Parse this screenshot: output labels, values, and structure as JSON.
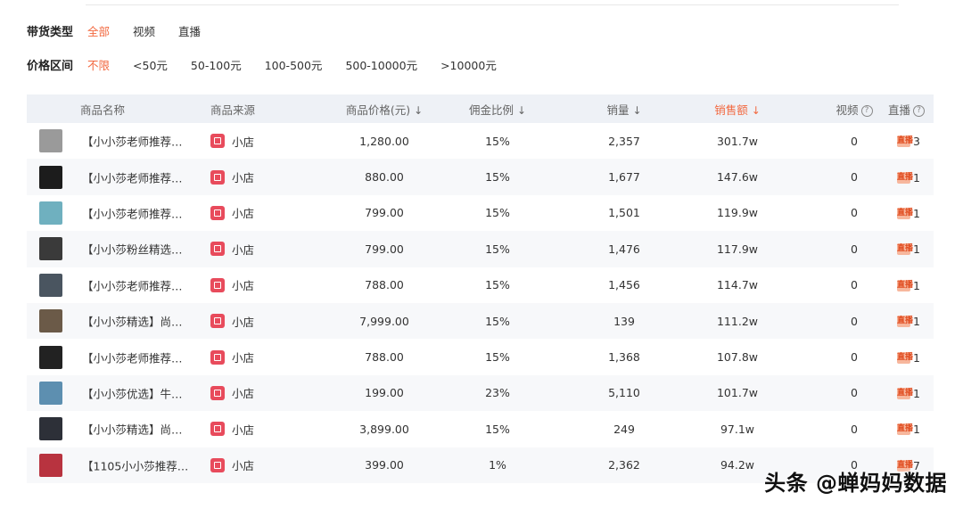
{
  "filters": {
    "type_label": "带货类型",
    "type_options": [
      "全部",
      "视频",
      "直播"
    ],
    "price_label": "价格区间",
    "price_options": [
      "不限",
      "<50元",
      "50-100元",
      "100-500元",
      "500-10000元",
      ">10000元"
    ]
  },
  "table": {
    "headers": {
      "name": "商品名称",
      "source": "商品来源",
      "price": "商品价格(元)",
      "commission": "佣金比例",
      "sales": "销量",
      "revenue": "销售额",
      "video": "视频",
      "live": "直播"
    },
    "sort_arrow": "↓",
    "help_glyph": "?",
    "live_icon_text": "直播",
    "rows": [
      {
        "name": "【小小莎老师推荐…",
        "source": "小店",
        "price": "1,280.00",
        "commission": "15%",
        "sales": "2,357",
        "revenue": "301.7w",
        "video": "0",
        "live": "3",
        "thumb_color": "#9a9a9a"
      },
      {
        "name": "【小小莎老师推荐…",
        "source": "小店",
        "price": "880.00",
        "commission": "15%",
        "sales": "1,677",
        "revenue": "147.6w",
        "video": "0",
        "live": "1",
        "thumb_color": "#1c1c1c"
      },
      {
        "name": "【小小莎老师推荐…",
        "source": "小店",
        "price": "799.00",
        "commission": "15%",
        "sales": "1,501",
        "revenue": "119.9w",
        "video": "0",
        "live": "1",
        "thumb_color": "#6fb0bf"
      },
      {
        "name": "【小小莎粉丝精选…",
        "source": "小店",
        "price": "799.00",
        "commission": "15%",
        "sales": "1,476",
        "revenue": "117.9w",
        "video": "0",
        "live": "1",
        "thumb_color": "#3a3a3a"
      },
      {
        "name": "【小小莎老师推荐…",
        "source": "小店",
        "price": "788.00",
        "commission": "15%",
        "sales": "1,456",
        "revenue": "114.7w",
        "video": "0",
        "live": "1",
        "thumb_color": "#4a5560"
      },
      {
        "name": "【小小莎精选】尚…",
        "source": "小店",
        "price": "7,999.00",
        "commission": "15%",
        "sales": "139",
        "revenue": "111.2w",
        "video": "0",
        "live": "1",
        "thumb_color": "#6b5a48"
      },
      {
        "name": "【小小莎老师推荐…",
        "source": "小店",
        "price": "788.00",
        "commission": "15%",
        "sales": "1,368",
        "revenue": "107.8w",
        "video": "0",
        "live": "1",
        "thumb_color": "#222222"
      },
      {
        "name": "【小小莎优选】牛…",
        "source": "小店",
        "price": "199.00",
        "commission": "23%",
        "sales": "5,110",
        "revenue": "101.7w",
        "video": "0",
        "live": "1",
        "thumb_color": "#5d8fb0"
      },
      {
        "name": "【小小莎精选】尚…",
        "source": "小店",
        "price": "3,899.00",
        "commission": "15%",
        "sales": "249",
        "revenue": "97.1w",
        "video": "0",
        "live": "1",
        "thumb_color": "#2d3038"
      },
      {
        "name": "【1105小小莎推荐…",
        "source": "小店",
        "price": "399.00",
        "commission": "1%",
        "sales": "2,362",
        "revenue": "94.2w",
        "video": "0",
        "live": "7",
        "thumb_color": "#b8333f"
      }
    ]
  },
  "watermark": "头条 @蝉妈妈数据",
  "colors": {
    "accent": "#f2683f",
    "header_bg": "#eef1f6",
    "stripe": "#f7f8fa",
    "shop_red": "#e84b5c"
  }
}
